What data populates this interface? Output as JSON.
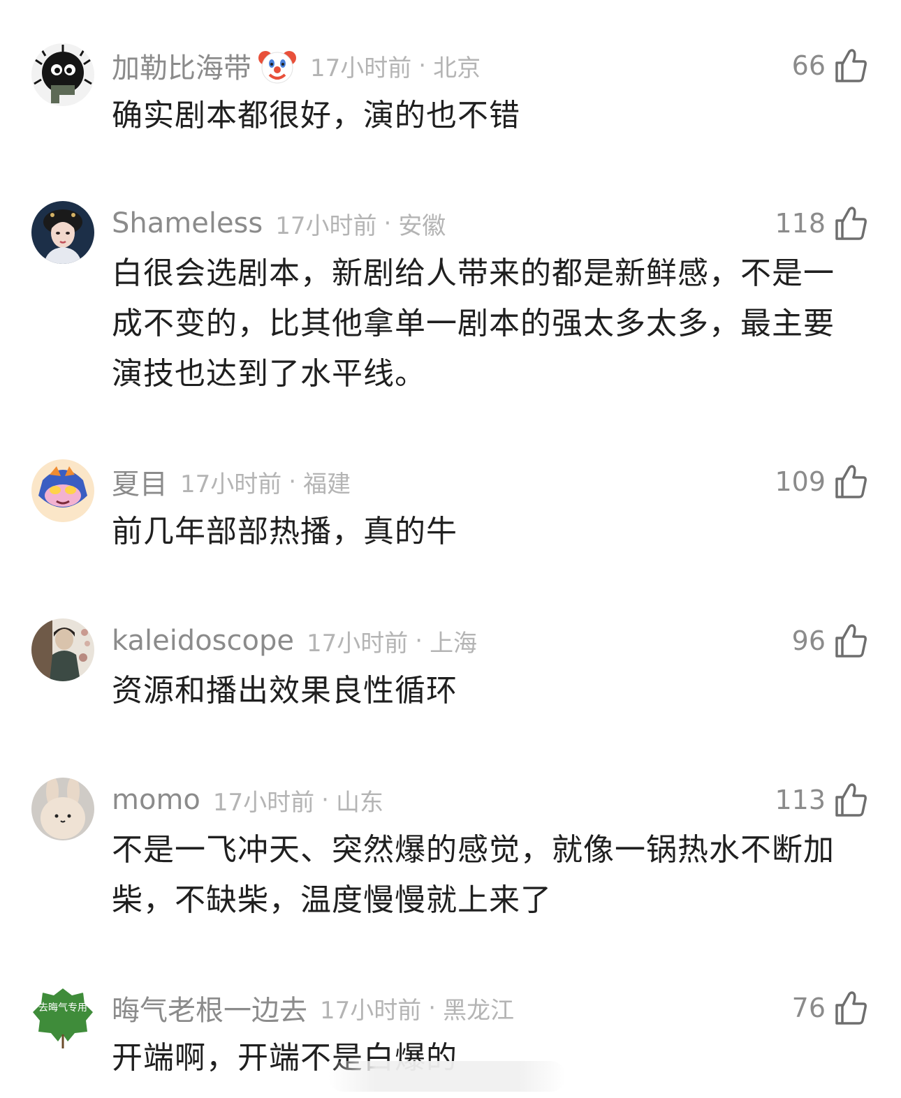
{
  "comments": [
    {
      "username": "加勒比海带",
      "emoji": "clown-face-icon",
      "time": "17小时前",
      "location": "北京",
      "likes": "66",
      "text": "确实剧本都很好，演的也不错"
    },
    {
      "username": "Shameless",
      "time": "17小时前",
      "location": "安徽",
      "likes": "118",
      "text": "白很会选剧本，新剧给人带来的都是新鲜感，不是一成不变的，比其他拿单一剧本的强太多太多，最主要演技也达到了水平线。"
    },
    {
      "username": "夏目",
      "time": "17小时前",
      "location": "福建",
      "likes": "109",
      "text": "前几年部部热播，真的牛"
    },
    {
      "username": "kaleidoscope",
      "time": "17小时前",
      "location": "上海",
      "likes": "96",
      "text": "资源和播出效果良性循环"
    },
    {
      "username": "momo",
      "time": "17小时前",
      "location": "山东",
      "likes": "113",
      "text": "不是一飞冲天、突然爆的感觉，就像一锅热水不断加柴，不缺柴，温度慢慢就上来了"
    },
    {
      "username": "晦气老根一边去",
      "avatar_text": "去晦气专用",
      "time": "17小时前",
      "location": "黑龙江",
      "likes": "76",
      "text": "开端啊，开端不是白爆的"
    }
  ],
  "separator": "·",
  "icons": {
    "like": "thumbs-up-icon"
  }
}
